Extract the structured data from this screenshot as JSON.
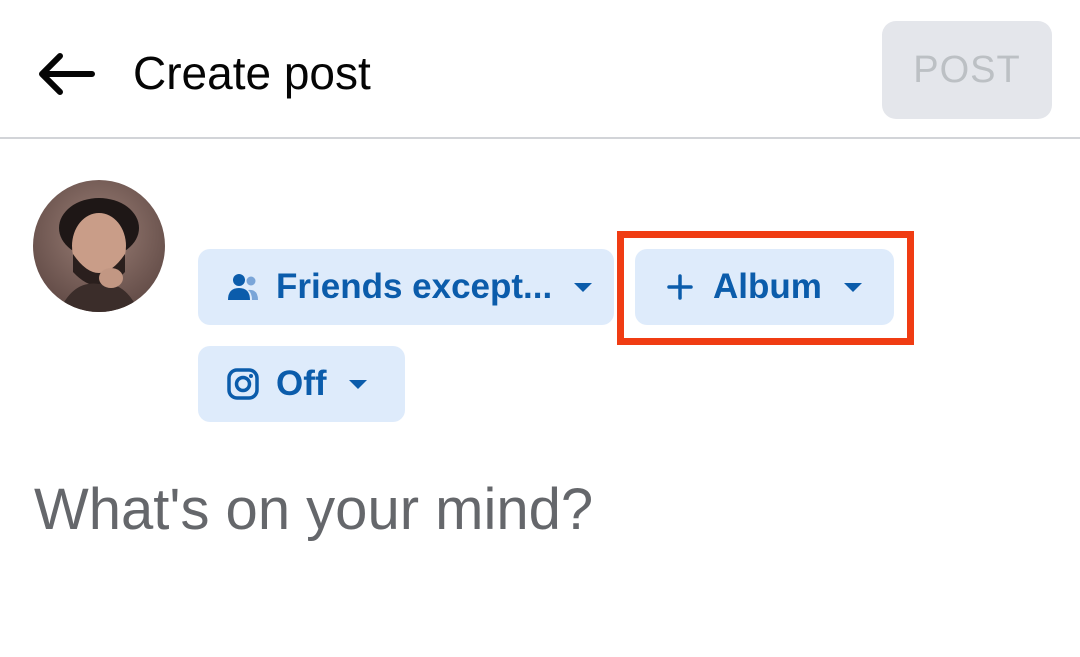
{
  "header": {
    "back_icon": "arrow-left-icon",
    "title": "Create post",
    "post_label": "POST"
  },
  "composer": {
    "avatar_icon": "user-avatar",
    "audience_icon": "people-icon",
    "audience_label": "Friends except...",
    "album_icon": "plus-icon",
    "album_label": "Album",
    "instagram_icon": "instagram-icon",
    "instagram_label": "Off",
    "placeholder": "What's on your mind?"
  },
  "colors": {
    "accent": "#0b5cab",
    "chip_bg": "#deebfb",
    "post_disabled_bg": "#e4e6eb",
    "post_disabled_text": "#bcc0c4",
    "highlight": "#f03c13",
    "placeholder_text": "#65676b"
  }
}
